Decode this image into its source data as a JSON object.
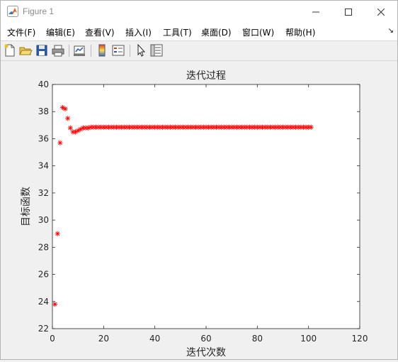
{
  "window": {
    "title": "Figure 1",
    "controls": {
      "minimize": "minimize",
      "maximize": "maximize",
      "close": "close"
    }
  },
  "menubar": {
    "items": [
      "文件(F)",
      "编辑(E)",
      "查看(V)",
      "插入(I)",
      "工具(T)",
      "桌面(D)",
      "窗口(W)",
      "帮助(H)"
    ],
    "overflow_icon": "chevron-icon"
  },
  "toolbar": {
    "buttons": [
      "new-figure-icon",
      "open-file-icon",
      "save-icon",
      "print-icon",
      "link-plot-icon",
      "insert-colorbar-icon",
      "insert-legend-icon",
      "edit-plot-icon",
      "property-inspector-icon"
    ]
  },
  "chart_data": {
    "type": "scatter",
    "title": "迭代过程",
    "xlabel": "迭代次数",
    "ylabel": "目标函数",
    "xlim": [
      0,
      120
    ],
    "ylim": [
      22,
      40
    ],
    "xticks": [
      0,
      20,
      40,
      60,
      80,
      100,
      120
    ],
    "yticks": [
      22,
      24,
      26,
      28,
      30,
      32,
      34,
      36,
      38,
      40
    ],
    "marker": "*",
    "color": "#ff0000",
    "grid": false,
    "series": [
      {
        "x": [
          1,
          2,
          3,
          4,
          5,
          6,
          7,
          8,
          9,
          10,
          11,
          12,
          13,
          14,
          15,
          16,
          17,
          18,
          19,
          20,
          21,
          22,
          23,
          24,
          25,
          26,
          27,
          28,
          29,
          30,
          31,
          32,
          33,
          34,
          35,
          36,
          37,
          38,
          39,
          40,
          41,
          42,
          43,
          44,
          45,
          46,
          47,
          48,
          49,
          50,
          51,
          52,
          53,
          54,
          55,
          56,
          57,
          58,
          59,
          60,
          61,
          62,
          63,
          64,
          65,
          66,
          67,
          68,
          69,
          70,
          71,
          72,
          73,
          74,
          75,
          76,
          77,
          78,
          79,
          80,
          81,
          82,
          83,
          84,
          85,
          86,
          87,
          88,
          89,
          90,
          91,
          92,
          93,
          94,
          95,
          96,
          97,
          98,
          99,
          100,
          101
        ],
        "y": [
          23.8,
          29.0,
          35.7,
          38.3,
          38.2,
          37.5,
          36.8,
          36.5,
          36.5,
          36.6,
          36.7,
          36.8,
          36.8,
          36.8,
          36.85,
          36.85,
          36.85,
          36.85,
          36.85,
          36.85,
          36.85,
          36.85,
          36.85,
          36.85,
          36.85,
          36.85,
          36.85,
          36.85,
          36.85,
          36.85,
          36.85,
          36.85,
          36.85,
          36.85,
          36.85,
          36.85,
          36.85,
          36.85,
          36.85,
          36.85,
          36.85,
          36.85,
          36.85,
          36.85,
          36.85,
          36.85,
          36.85,
          36.85,
          36.85,
          36.85,
          36.85,
          36.85,
          36.85,
          36.85,
          36.85,
          36.85,
          36.85,
          36.85,
          36.85,
          36.85,
          36.85,
          36.85,
          36.85,
          36.85,
          36.85,
          36.85,
          36.85,
          36.85,
          36.85,
          36.85,
          36.85,
          36.85,
          36.85,
          36.85,
          36.85,
          36.85,
          36.85,
          36.85,
          36.85,
          36.85,
          36.85,
          36.85,
          36.85,
          36.85,
          36.85,
          36.85,
          36.85,
          36.85,
          36.85,
          36.85,
          36.85,
          36.85,
          36.85,
          36.85,
          36.85,
          36.85,
          36.85,
          36.85,
          36.85,
          36.85,
          36.85
        ]
      }
    ]
  }
}
